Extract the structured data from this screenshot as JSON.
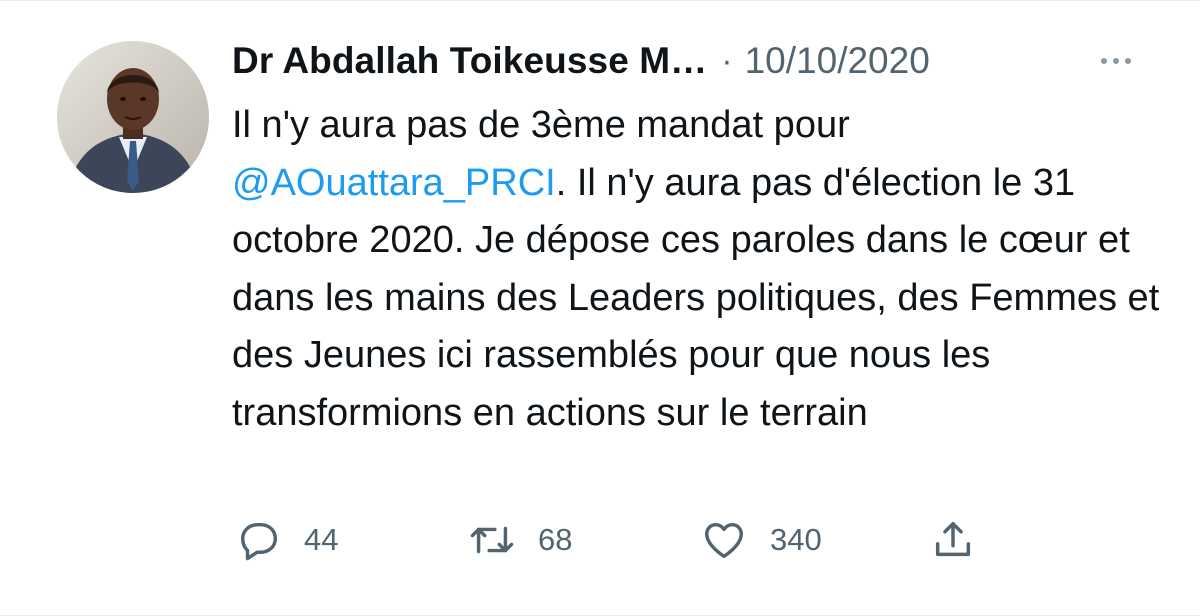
{
  "tweet": {
    "author_name": "Dr Abdallah Toikeusse M…",
    "separator": "·",
    "date": "10/10/2020",
    "more_icon": "more-horizontal-icon",
    "text_part1": "Il n'y aura pas de 3ème mandat pour ",
    "mention": "@AOuattara_PRCI",
    "text_part2": ". Il n'y aura pas d'élection le 31 octobre 2020. Je dépose ces paroles dans le cœur et dans les mains des Leaders politiques, des Femmes et des Jeunes ici rassemblés pour que nous les transformions en actions sur le terrain"
  },
  "actions": {
    "reply": {
      "icon": "reply-icon",
      "count": "44"
    },
    "retweet": {
      "icon": "retweet-icon",
      "count": "68"
    },
    "like": {
      "icon": "heart-icon",
      "count": "340"
    },
    "share": {
      "icon": "share-icon"
    }
  },
  "colors": {
    "text": "#0f1419",
    "secondary": "#536471",
    "link": "#1d9bf0",
    "border": "#e6ecf0"
  }
}
